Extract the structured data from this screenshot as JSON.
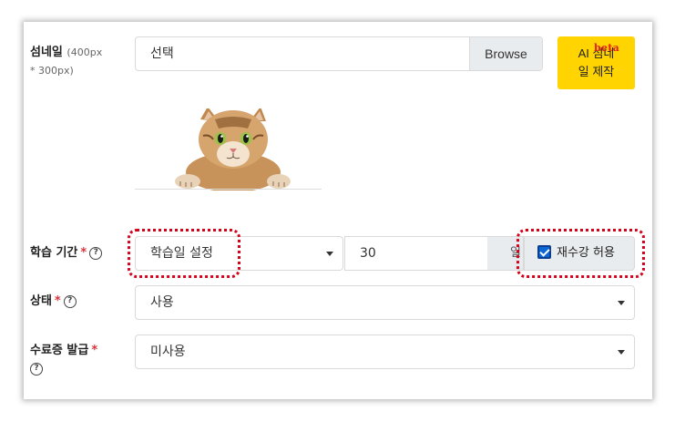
{
  "thumbnail": {
    "label": "섬네일",
    "size_hint": "(400px",
    "size_hint2": "* 300px)",
    "file_placeholder": "선택",
    "browse_label": "Browse",
    "ai_button_line1": "AI 섬네",
    "ai_button_line2": "일 제작",
    "beta_badge": "beta"
  },
  "study_period": {
    "label": "학습 기간",
    "required_mark": "*",
    "help_icon": "?",
    "select_value": "학습일 설정",
    "days_value": "30",
    "days_unit": "일",
    "retake_label": "재수강 허용",
    "retake_checked": true
  },
  "status": {
    "label": "상태",
    "required_mark": "*",
    "help_icon": "?",
    "select_value": "사용"
  },
  "certificate": {
    "label": "수료증 발급",
    "required_mark": "*",
    "help_icon": "?",
    "select_value": "미사용"
  },
  "colors": {
    "accent_yellow": "#ffd400",
    "highlight_red": "#d4021b",
    "checkbox_blue": "#0b67d4"
  }
}
